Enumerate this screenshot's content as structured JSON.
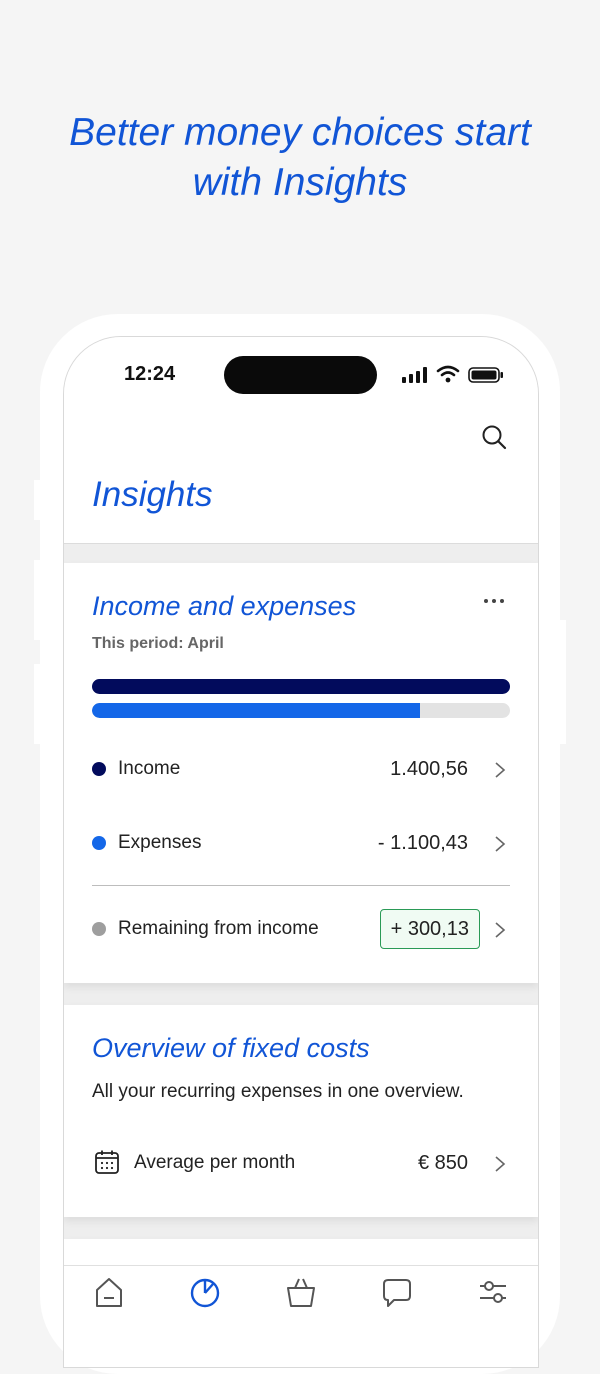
{
  "headline": {
    "line1": "Better money choices start",
    "line2": "with Insights"
  },
  "status_bar": {
    "time": "12:24"
  },
  "colors": {
    "accent": "#1155d6",
    "income": "#020b5c",
    "expenses": "#1467e8",
    "remaining": "#9e9e9e",
    "positive_border": "#2a9a56"
  },
  "page": {
    "title": "Insights"
  },
  "income_expenses": {
    "title": "Income and expenses",
    "period": "This period: April",
    "income_fraction": 1.0,
    "expenses_fraction": 0.7856,
    "rows": [
      {
        "label": "Income",
        "value": "1.400,56"
      },
      {
        "label": "Expenses",
        "value": "- 1.100,43"
      },
      {
        "label": "Remaining from income",
        "value": "+ 300,13"
      }
    ]
  },
  "fixed_costs": {
    "title": "Overview of fixed costs",
    "subtitle": "All your recurring expenses in one overview.",
    "avg_label": "Average per month",
    "avg_value": "€ 850"
  },
  "icons": {
    "search": "search-icon",
    "more": "more-icon",
    "calendar": "calendar-icon",
    "tabs": [
      "home-icon",
      "insights-pie-icon",
      "basket-icon",
      "chat-icon",
      "sliders-icon"
    ]
  }
}
